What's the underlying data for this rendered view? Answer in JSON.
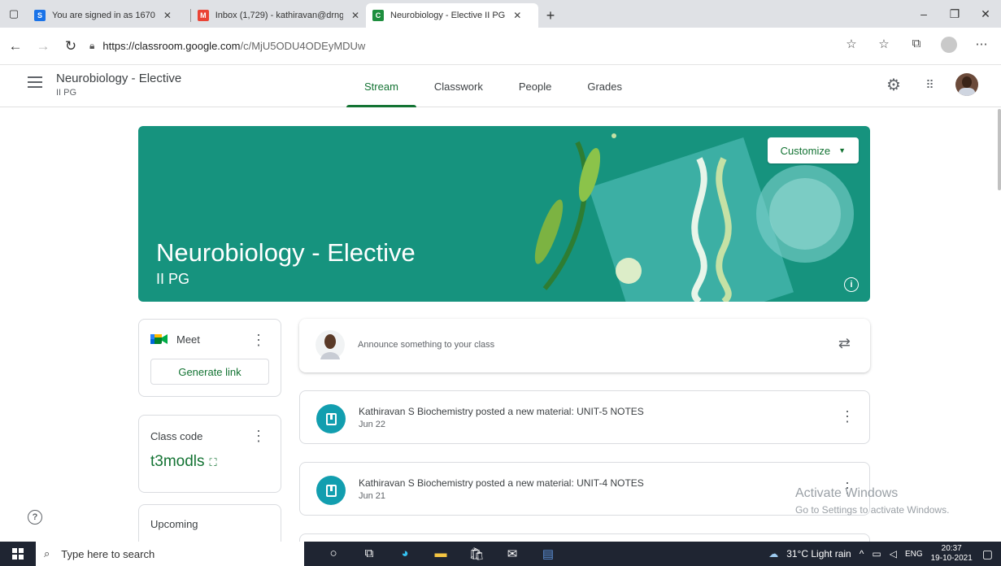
{
  "browser": {
    "tabs": [
      {
        "title": "You are signed in as 1670",
        "fav_letter": "S",
        "fav_color": "#1a73e8"
      },
      {
        "title": "Inbox (1,729) - kathiravan@drng",
        "fav_letter": "M",
        "fav_color": "#ea4335"
      },
      {
        "title": "Neurobiology - Elective II PG",
        "fav_letter": "C",
        "fav_color": "#1e8e3e"
      }
    ],
    "url_host": "https://classroom.google.com",
    "url_path": "/c/MjU5ODU4ODEyMDUw"
  },
  "header": {
    "title": "Neurobiology - Elective",
    "section": "II PG",
    "tabs": [
      "Stream",
      "Classwork",
      "People",
      "Grades"
    ]
  },
  "banner": {
    "title": "Neurobiology - Elective",
    "subtitle": "II PG",
    "customize_label": "Customize",
    "color": "#16937e"
  },
  "meet": {
    "label": "Meet",
    "button": "Generate link"
  },
  "class_code": {
    "label": "Class code",
    "code": "t3modls"
  },
  "upcoming": {
    "label": "Upcoming"
  },
  "announce": {
    "placeholder": "Announce something to your class"
  },
  "posts": [
    {
      "title": "Kathiravan S Biochemistry posted a new material: UNIT-5 NOTES",
      "date": "Jun 22"
    },
    {
      "title": "Kathiravan S Biochemistry posted a new material: UNIT-4 NOTES",
      "date": "Jun 21"
    }
  ],
  "watermark": {
    "line1": "Activate Windows",
    "line2": "Go to Settings to activate Windows."
  },
  "taskbar": {
    "search_placeholder": "Type here to search",
    "weather": "31°C  Light rain",
    "lang": "ENG",
    "time": "20:37",
    "date": "19-10-2021"
  },
  "accent": "#137333"
}
